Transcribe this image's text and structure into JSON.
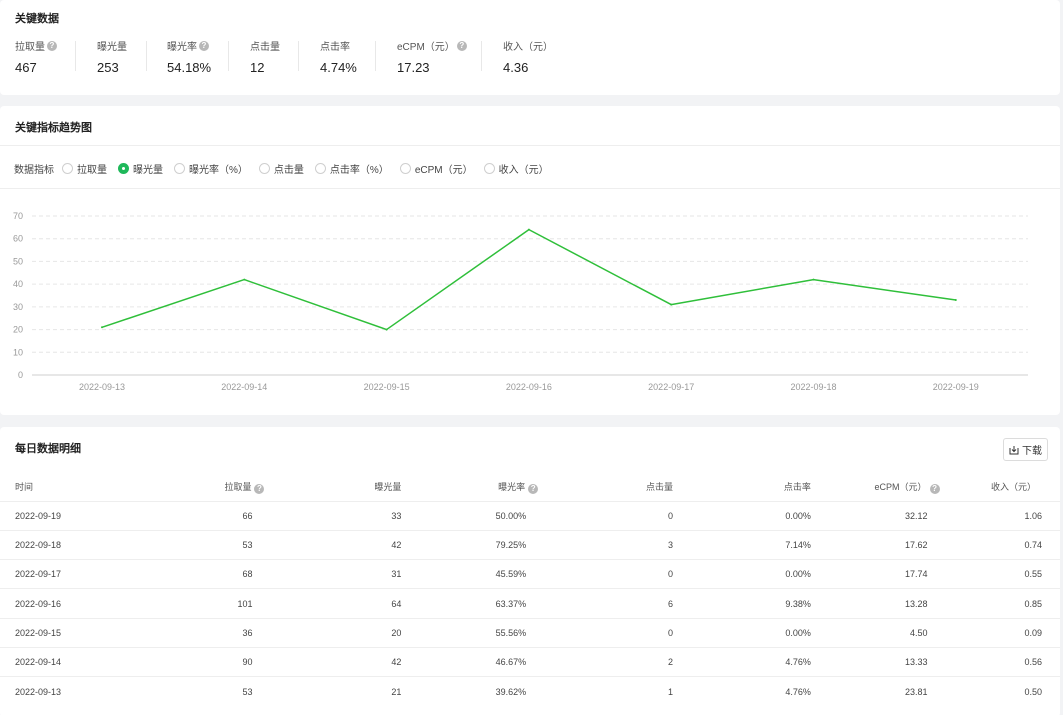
{
  "key_data": {
    "title": "关键数据",
    "metrics": [
      {
        "label": "拉取量",
        "value": "467",
        "help": true
      },
      {
        "label": "曝光量",
        "value": "253",
        "help": false
      },
      {
        "label": "曝光率",
        "value": "54.18%",
        "help": true
      },
      {
        "label": "点击量",
        "value": "12",
        "help": false
      },
      {
        "label": "点击率",
        "value": "4.74%",
        "help": false
      },
      {
        "label": "eCPM（元）",
        "value": "17.23",
        "help": true
      },
      {
        "label": "收入（元）",
        "value": "4.36",
        "help": false
      }
    ]
  },
  "trend": {
    "title": "关键指标趋势图",
    "selector_label": "数据指标",
    "options": [
      "拉取量",
      "曝光量",
      "曝光率（%）",
      "点击量",
      "点击率（%）",
      "eCPM（元）",
      "收入（元）"
    ],
    "selected": "曝光量",
    "line_color": "#2fbf3a"
  },
  "chart_data": {
    "type": "line",
    "x": [
      "2022-09-13",
      "2022-09-14",
      "2022-09-15",
      "2022-09-16",
      "2022-09-17",
      "2022-09-18",
      "2022-09-19"
    ],
    "series": [
      {
        "values": [
          21,
          42,
          20,
          64,
          31,
          42,
          33
        ]
      }
    ],
    "ylim": [
      0,
      70
    ],
    "yticks": [
      0,
      10,
      20,
      30,
      40,
      50,
      60,
      70
    ],
    "grid": true
  },
  "daily": {
    "title": "每日数据明细",
    "download_label": "下载",
    "columns": [
      {
        "label": "时间",
        "help": false
      },
      {
        "label": "拉取量",
        "help": true
      },
      {
        "label": "曝光量",
        "help": false
      },
      {
        "label": "曝光率",
        "help": true
      },
      {
        "label": "点击量",
        "help": false
      },
      {
        "label": "点击率",
        "help": false
      },
      {
        "label": "eCPM（元）",
        "help": true
      },
      {
        "label": "收入（元）",
        "help": false
      }
    ],
    "rows": [
      [
        "2022-09-19",
        "66",
        "33",
        "50.00%",
        "0",
        "0.00%",
        "32.12",
        "1.06"
      ],
      [
        "2022-09-18",
        "53",
        "42",
        "79.25%",
        "3",
        "7.14%",
        "17.62",
        "0.74"
      ],
      [
        "2022-09-17",
        "68",
        "31",
        "45.59%",
        "0",
        "0.00%",
        "17.74",
        "0.55"
      ],
      [
        "2022-09-16",
        "101",
        "64",
        "63.37%",
        "6",
        "9.38%",
        "13.28",
        "0.85"
      ],
      [
        "2022-09-15",
        "36",
        "20",
        "55.56%",
        "0",
        "0.00%",
        "4.50",
        "0.09"
      ],
      [
        "2022-09-14",
        "90",
        "42",
        "46.67%",
        "2",
        "4.76%",
        "13.33",
        "0.56"
      ],
      [
        "2022-09-13",
        "53",
        "21",
        "39.62%",
        "1",
        "4.76%",
        "23.81",
        "0.50"
      ]
    ]
  }
}
